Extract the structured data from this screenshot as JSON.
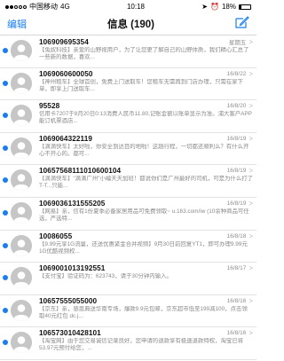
{
  "status_bar": {
    "carrier": "中国移动",
    "network": "4G",
    "time": "10:18",
    "battery_pct": "18%",
    "battery_level": 0.18
  },
  "nav": {
    "edit_label": "编辑",
    "title": "信息 (190)"
  },
  "messages": [
    {
      "sender": "106909695354",
      "time": "星期五",
      "preview": "【兔奴科技】亲爱的山野视用户，为了让您更了解自己的山野体质，我们精心汇总了一些新的数据，喜欢..."
    },
    {
      "sender": "1069060600050",
      "time": "16/8/22",
      "preview": "【神州租车】全球首创，免费上门送取车！您租车无需再到门店办理，只需在家下单，即享上门送取车..."
    },
    {
      "sender": "95528",
      "time": "16/8/20",
      "preview": "信用卡7207于8月20日0:13消费人民币11.80,记账金额以账单显示为准。浦大客户APP能订机票酒店..."
    },
    {
      "sender": "1069064322119",
      "time": "16/8/19",
      "preview": "【滴滴快车】太好啦，你安全到达目的地啦！这趟行程，一切都还顺利么？有什么开心不开心的。都可..."
    },
    {
      "sender": "10657568111010600104",
      "time": "16/8/19",
      "preview": "【滴滴快车】\"滴滴广州\"小编天天加班！都说你们是广州最好的司机，可是为什么打了T-T...只能..."
    },
    {
      "sender": "1069036131555205",
      "time": "16/8/19",
      "preview": "【网易】亲，信有1份夏季必备家居用品可免费领取~ u.163.com/iw (10余种商品可任选，严选特..."
    },
    {
      "sender": "10086055",
      "time": "16/8/18",
      "preview": "【9.99元享1G流量，还送优惠紧金合并视频】9月30日前回复YT1，即可办理9.99元1G优酷视频权..."
    },
    {
      "sender": "1069001013192551",
      "time": "16/8/17",
      "preview": "【支付宝】验证码为：623743，请于30分钟内输入。"
    },
    {
      "sender": "10657555055000",
      "time": "16/8/16",
      "preview": "【京东】亲，感恩典送华南专场，爆款9.9元包邮，京东超市低至199减100，点击领取40元红包 dc.j..."
    },
    {
      "sender": "106573010428101",
      "time": "16/8/16",
      "preview": "【淘宝网】由于您交易诚信记录良好，您申请的退款享有极速退款特权，淘宝已将53.97元预付给您，..."
    }
  ]
}
